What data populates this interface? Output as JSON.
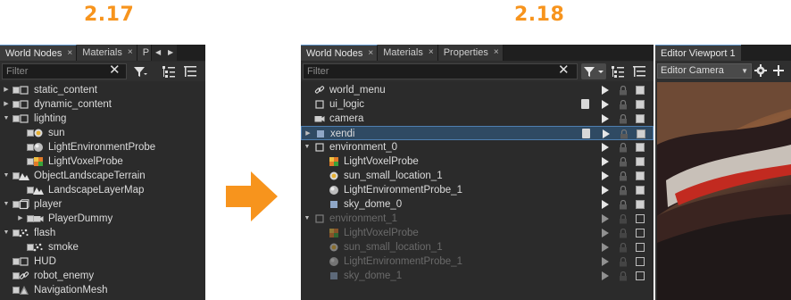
{
  "versions": {
    "old": "2.17",
    "new": "2.18"
  },
  "colors": {
    "accent": "#f7941d",
    "selection": "#2f4a63",
    "panel_bg": "#2b2b2b"
  },
  "old_panel": {
    "tabs": [
      "World Nodes",
      "Materials",
      "P"
    ],
    "close_glyph": "×",
    "filter_placeholder": "Filter",
    "filter_clear": "✕",
    "rows": [
      {
        "label": "static_content",
        "icon": "square-outline-icon"
      },
      {
        "label": "dynamic_content",
        "icon": "square-outline-icon"
      },
      {
        "label": "lighting",
        "icon": "square-outline-icon"
      },
      {
        "label": "sun",
        "icon": "sun-icon"
      },
      {
        "label": "LightEnvironmentProbe",
        "icon": "probe-sphere-icon"
      },
      {
        "label": "LightVoxelProbe",
        "icon": "voxel-cube-icon"
      },
      {
        "label": "ObjectLandscapeTerrain",
        "icon": "landscape-icon"
      },
      {
        "label": "LandscapeLayerMap",
        "icon": "landscape-icon"
      },
      {
        "label": "player",
        "icon": "player-cube-icon"
      },
      {
        "label": "PlayerDummy",
        "icon": "camera-icon"
      },
      {
        "label": "flash",
        "icon": "particles-icon"
      },
      {
        "label": "smoke",
        "icon": "particles-icon"
      },
      {
        "label": "HUD",
        "icon": "square-outline-icon"
      },
      {
        "label": "robot_enemy",
        "icon": "link-icon"
      },
      {
        "label": "NavigationMesh",
        "icon": "navmesh-icon"
      }
    ]
  },
  "new_panel": {
    "tabs": [
      "World Nodes",
      "Materials",
      "Properties"
    ],
    "close_glyph": "×",
    "filter_placeholder": "Filter",
    "filter_clear": "✕",
    "rows": [
      {
        "label": "world_menu",
        "icon": "link-icon"
      },
      {
        "label": "ui_logic",
        "icon": "square-outline-icon"
      },
      {
        "label": "camera",
        "icon": "camera-icon"
      },
      {
        "label": "xendi",
        "icon": "mesh-icon",
        "selected": true
      },
      {
        "label": "environment_0",
        "icon": "square-outline-icon"
      },
      {
        "label": "LightVoxelProbe",
        "icon": "voxel-cube-icon"
      },
      {
        "label": "sun_small_location_1",
        "icon": "sun-icon"
      },
      {
        "label": "LightEnvironmentProbe_1",
        "icon": "probe-sphere-icon"
      },
      {
        "label": "sky_dome_0",
        "icon": "mesh-icon"
      },
      {
        "label": "environment_1",
        "icon": "square-outline-icon",
        "dim": true
      },
      {
        "label": "LightVoxelProbe",
        "icon": "voxel-cube-icon",
        "dim": true
      },
      {
        "label": "sun_small_location_1",
        "icon": "sun-icon",
        "dim": true
      },
      {
        "label": "LightEnvironmentProbe_1",
        "icon": "probe-sphere-icon",
        "dim": true
      },
      {
        "label": "sky_dome_1",
        "icon": "mesh-icon",
        "dim": true
      }
    ]
  },
  "viewport": {
    "tab": "Editor Viewport 1",
    "camera_select": "Editor Camera"
  }
}
